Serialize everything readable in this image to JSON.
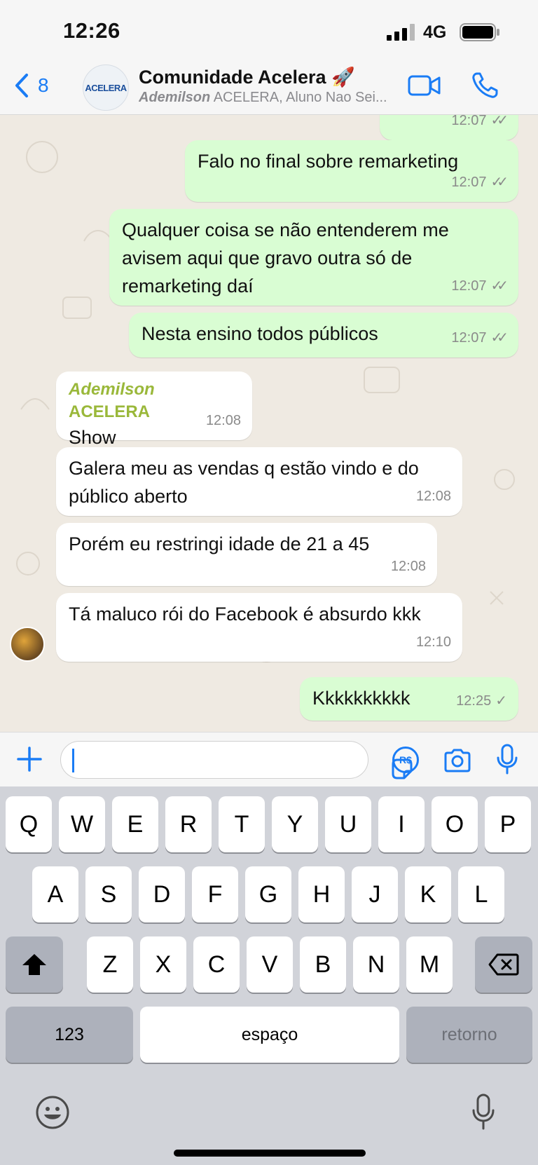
{
  "status_bar": {
    "time": "12:26",
    "network": "4G"
  },
  "header": {
    "back_count": "8",
    "group_avatar_text": "ACELERA",
    "title": "Comunidade Acelera 🚀",
    "subtitle_bold": "Ademilson",
    "subtitle_rest": " ACELERA, Aluno Nao Sei..."
  },
  "messages": [
    {
      "direction": "out",
      "text": "",
      "time": "12:07",
      "status": "read"
    },
    {
      "direction": "out",
      "text": "Falo no final sobre remarketing",
      "time": "12:07",
      "status": "read"
    },
    {
      "direction": "out",
      "text": "Qualquer coisa se não entenderem me avisem aqui que gravo outra só de remarketing daí",
      "time": "12:07",
      "status": "read"
    },
    {
      "direction": "out",
      "text": "Nesta ensino todos públicos",
      "time": "12:07",
      "status": "read"
    },
    {
      "direction": "in",
      "sender_first": "Ademilson",
      "sender_last": " ACELERA",
      "text": "Show",
      "time": "12:08"
    },
    {
      "direction": "in",
      "text": "Galera meu as vendas q estão vindo e do público aberto",
      "time": "12:08"
    },
    {
      "direction": "in",
      "text": "Porém eu restringi idade de 21 a 45",
      "time": "12:08"
    },
    {
      "direction": "in",
      "text": "Tá maluco rói do Facebook é absurdo kkk",
      "time": "12:10"
    },
    {
      "direction": "out",
      "text": "Kkkkkkkkkk",
      "time": "12:25",
      "status": "sent"
    }
  ],
  "input": {
    "value": "",
    "pay_label": "R$"
  },
  "keyboard": {
    "row1": [
      "Q",
      "W",
      "E",
      "R",
      "T",
      "Y",
      "U",
      "I",
      "O",
      "P"
    ],
    "row2": [
      "A",
      "S",
      "D",
      "F",
      "G",
      "H",
      "J",
      "K",
      "L"
    ],
    "row3": [
      "Z",
      "X",
      "C",
      "V",
      "B",
      "N",
      "M"
    ],
    "numbers_label": "123",
    "space_label": "espaço",
    "return_label": "retorno"
  },
  "colors": {
    "accent": "#1a7cf5",
    "outgoing_bubble": "#d9fdd3",
    "sender_name": "#9ab83a"
  },
  "icons": [
    "back-chevron-icon",
    "video-call-icon",
    "phone-call-icon",
    "plus-icon",
    "sticker-icon",
    "pay-icon",
    "camera-icon",
    "microphone-icon",
    "shift-icon",
    "backspace-icon",
    "emoji-icon",
    "dictation-icon"
  ]
}
